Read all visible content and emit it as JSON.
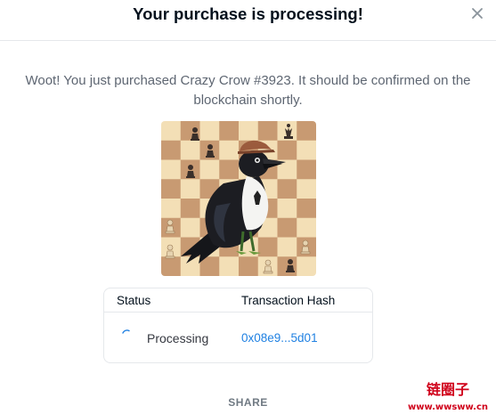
{
  "header": {
    "title": "Your purchase is processing!",
    "close_icon": "close-icon"
  },
  "message": "Woot! You just purchased Crazy Crow #3923. It should be confirmed on the blockchain shortly.",
  "nft": {
    "image_icon": "crow-on-chessboard-illustration"
  },
  "transaction": {
    "status_header": "Status",
    "hash_header": "Transaction Hash",
    "status_value": "Processing",
    "hash_value": "0x08e9...5d01",
    "spinner_icon": "loading-spinner-icon"
  },
  "share_label": "SHARE",
  "watermark": {
    "brand_text": "链圈子",
    "url_text": "www.wwsww.cn"
  },
  "colors": {
    "title": "#04111d",
    "message": "#5e6672",
    "link": "#2081e2",
    "border": "#e5e8eb",
    "board_light": "#f3dfb6",
    "board_dark": "#c89a72",
    "watermark": "#d0021b"
  }
}
